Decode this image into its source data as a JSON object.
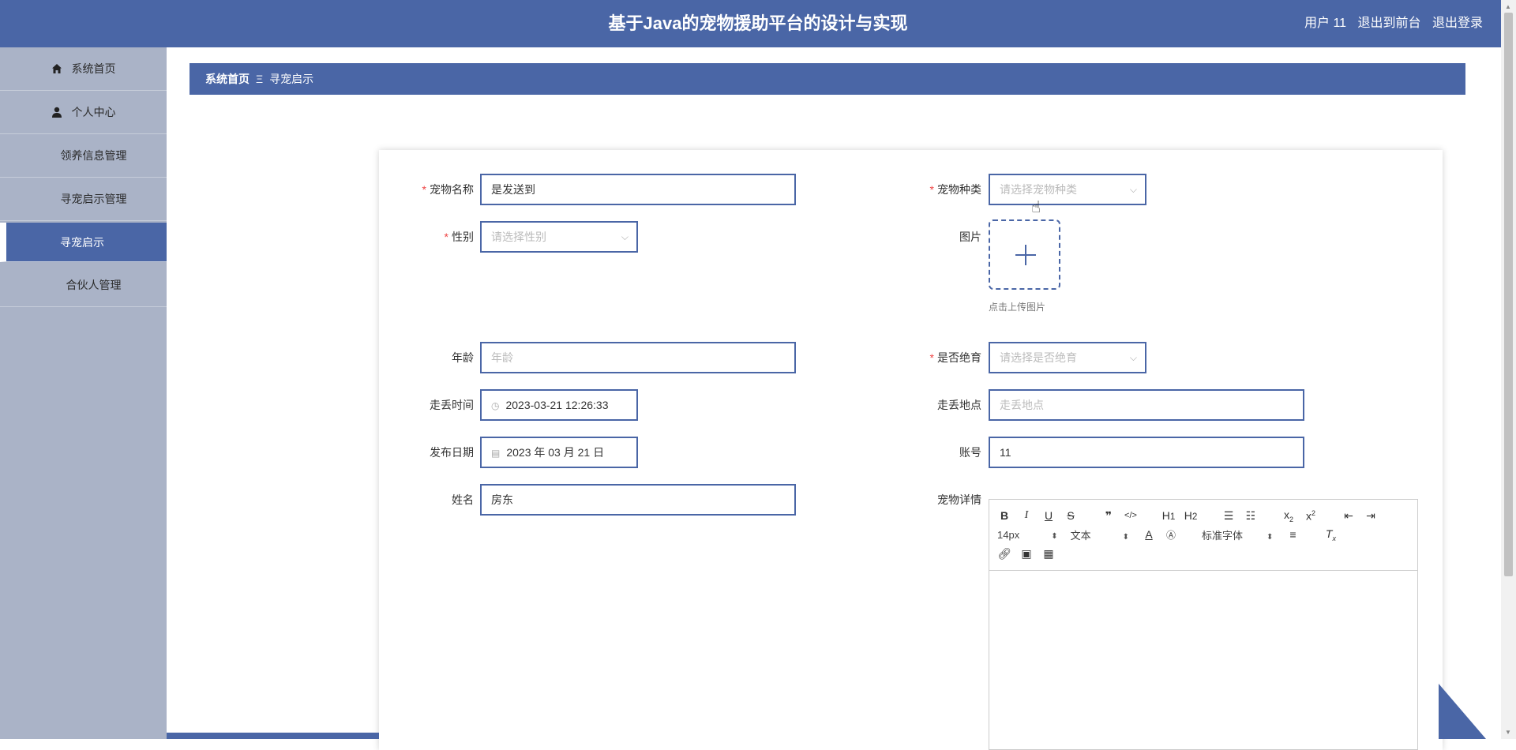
{
  "header": {
    "title": "基于Java的宠物援助平台的设计与实现",
    "user_label": "用户 11",
    "front_link": "退出到前台",
    "logout_link": "退出登录"
  },
  "sidebar": {
    "items": [
      {
        "label": "系统首页",
        "icon": "home-icon"
      },
      {
        "label": "个人中心",
        "icon": "user-icon"
      },
      {
        "label": "领养信息管理",
        "icon": "grid-icon"
      },
      {
        "label": "寻宠启示管理",
        "icon": "grid-icon"
      },
      {
        "label": "寻宠启示",
        "icon": "",
        "active": true
      },
      {
        "label": "合伙人管理",
        "icon": "grid-icon"
      }
    ]
  },
  "breadcrumb": {
    "home": "系统首页",
    "sep": "Ξ",
    "current": "寻宠启示"
  },
  "form": {
    "pet_name": {
      "label": "宠物名称",
      "value": "是发送到"
    },
    "pet_type": {
      "label": "宠物种类",
      "placeholder": "请选择宠物种类"
    },
    "gender": {
      "label": "性别",
      "placeholder": "请选择性别"
    },
    "image": {
      "label": "图片",
      "hint": "点击上传图片"
    },
    "age": {
      "label": "年龄",
      "placeholder": "年龄"
    },
    "sterilized": {
      "label": "是否绝育",
      "placeholder": "请选择是否绝育"
    },
    "lost_time": {
      "label": "走丢时间",
      "value": "2023-03-21 12:26:33"
    },
    "lost_place": {
      "label": "走丢地点",
      "placeholder": "走丢地点"
    },
    "publish_date": {
      "label": "发布日期",
      "value": "2023 年 03 月 21 日"
    },
    "account": {
      "label": "账号",
      "value": "11"
    },
    "name": {
      "label": "姓名",
      "value": "房东"
    },
    "detail": {
      "label": "宠物详情"
    }
  },
  "editor": {
    "font_size": "14px",
    "text_type": "文本",
    "font_family": "标准字体"
  },
  "colors": {
    "primary": "#4a66a6",
    "sidebar_bg": "#aab3c7",
    "required": "#e44444"
  }
}
